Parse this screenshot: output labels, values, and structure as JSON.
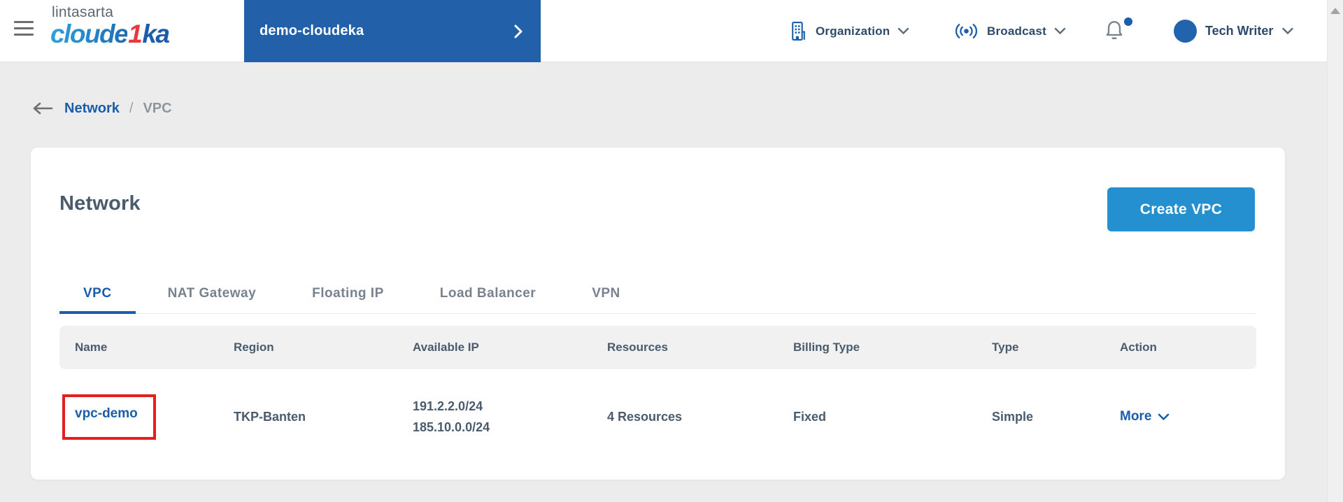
{
  "header": {
    "logo": {
      "top_text": "lintasarta",
      "brand_part1": "cloude",
      "brand_part2": "1",
      "brand_part3": "ka"
    },
    "project_banner": {
      "label": "demo-cloudeka"
    },
    "organization_menu": {
      "label": "Organization"
    },
    "broadcast_menu": {
      "label": "Broadcast"
    },
    "user_menu": {
      "name": "Tech Writer"
    }
  },
  "breadcrumb": {
    "section": "Network",
    "separator": "/",
    "current": "VPC"
  },
  "page": {
    "title": "Network",
    "create_button_label": "Create VPC",
    "tabs": [
      {
        "label": "VPC",
        "active": true
      },
      {
        "label": "NAT Gateway",
        "active": false
      },
      {
        "label": "Floating IP",
        "active": false
      },
      {
        "label": "Load Balancer",
        "active": false
      },
      {
        "label": "VPN",
        "active": false
      }
    ],
    "table": {
      "columns": [
        "Name",
        "Region",
        "Available IP",
        "Resources",
        "Billing Type",
        "Type",
        "Action"
      ],
      "rows": [
        {
          "name": "vpc-demo",
          "region": "TKP-Banten",
          "available_ip": [
            "191.2.2.0/24",
            "185.10.0.0/24"
          ],
          "resources": "4 Resources",
          "billing_type": "Fixed",
          "type": "Simple",
          "action_label": "More"
        }
      ]
    }
  },
  "colors": {
    "banner_blue": "#2261aa",
    "accent_blue": "#1a5dab",
    "button_blue": "#2590cf",
    "logo_red": "#e6393d",
    "highlight_red": "#e61e1e",
    "page_background": "#ececec",
    "table_header_background": "#f1f1f1"
  }
}
